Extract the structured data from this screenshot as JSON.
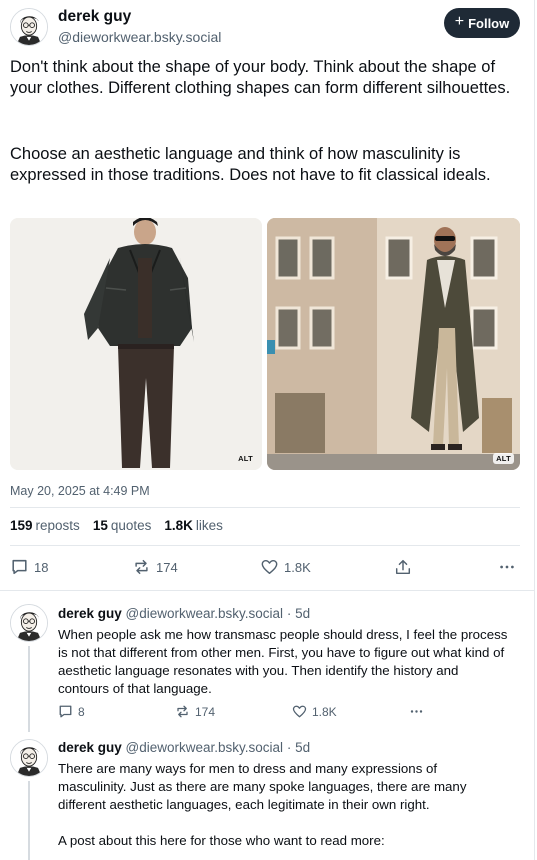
{
  "post": {
    "author_name": "derek guy",
    "author_handle": "@dieworkwear.bsky.social",
    "follow_label": "Follow",
    "paragraph1": "Don't think about the shape of your body. Think about the shape of your clothes. Different clothing shapes can form different silhouettes.",
    "paragraph2": "Choose an aesthetic language and think of how masculinity is expressed in those traditions. Does not have to fit classical ideals.",
    "images": [
      {
        "alt_badge": "ALT"
      },
      {
        "alt_badge": "ALT"
      }
    ],
    "timestamp": "May 20, 2025 at 4:49 PM",
    "stats": {
      "reposts_count": "159",
      "reposts_label": "reposts",
      "quotes_count": "15",
      "quotes_label": "quotes",
      "likes_count": "1.8K",
      "likes_label": "likes"
    },
    "actions": {
      "replies": "18",
      "reposts": "174",
      "likes": "1.8K"
    }
  },
  "replies": [
    {
      "author_name": "derek guy",
      "author_handle": "@dieworkwear.bsky.social",
      "age": "· 5d",
      "text": "When people ask me how transmasc people should dress, I feel the process is not that different from other men. First, you have to figure out what kind of aesthetic language resonates with you. Then identify the history and contours of that language.",
      "replies": "8",
      "reposts": "174",
      "likes": "1.8K"
    },
    {
      "author_name": "derek guy",
      "author_handle": "@dieworkwear.bsky.social",
      "age": "· 5d",
      "text1": "There are many ways for men to dress and many expressions of masculinity. Just as there are many spoke languages, there are many different aesthetic languages, each legitimate in their own right.",
      "text2": "A post about this here for those who want to read more:"
    }
  ],
  "colors": {
    "follow_bg": "#1f2a36",
    "muted_text": "#52616f",
    "divider": "#e4e8ec"
  }
}
